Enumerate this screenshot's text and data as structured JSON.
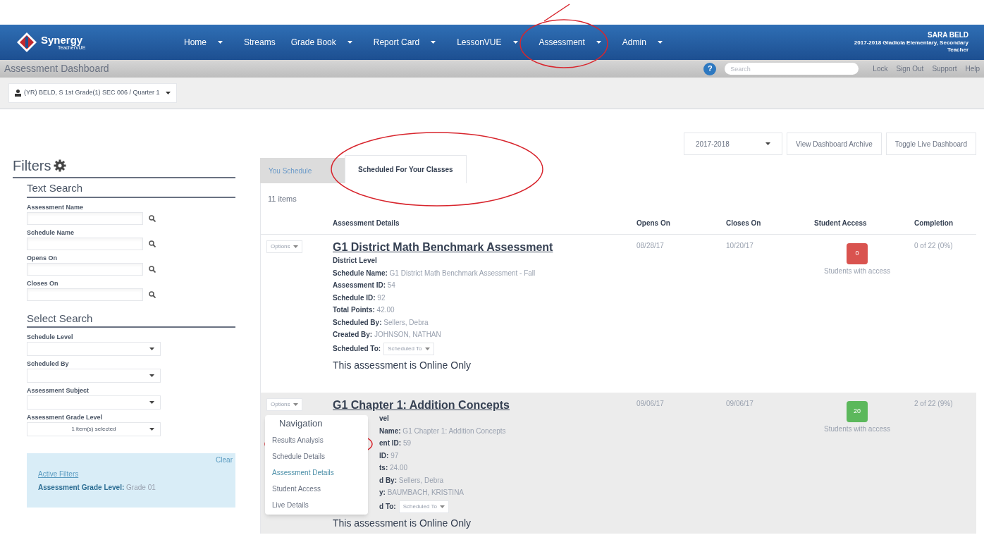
{
  "top_nav": {
    "logo_text": "Synergy",
    "logo_sub": "TeacherVUE",
    "items": [
      {
        "label": "Home",
        "dropdown": true
      },
      {
        "label": "Streams",
        "dropdown": false
      },
      {
        "label": "Grade Book",
        "dropdown": true
      },
      {
        "label": "Report Card",
        "dropdown": true
      },
      {
        "label": "LessonVUE",
        "dropdown": true
      },
      {
        "label": "Assessment",
        "dropdown": true
      },
      {
        "label": "Admin",
        "dropdown": true
      }
    ],
    "user": {
      "name": "SARA BELD",
      "school": "2017-2018 Gladiola Elementary, Secondary",
      "role": "Teacher"
    }
  },
  "sub_bar": {
    "title": "Assessment Dashboard",
    "help_icon": "?",
    "search": {
      "placeholder": "Search"
    },
    "links": [
      "Lock",
      "Sign Out",
      "Support",
      "Help"
    ]
  },
  "section_selector": "(YR) BELD, S 1st Grade(1) SEC 006 / Quarter 1",
  "filters": {
    "title": "Filters",
    "text_search": {
      "title": "Text Search",
      "fields": [
        {
          "label": "Assessment Name"
        },
        {
          "label": "Schedule Name"
        },
        {
          "label": "Opens On"
        },
        {
          "label": "Closes On"
        }
      ]
    },
    "select_search": {
      "title": "Select Search",
      "fields": [
        {
          "label": "Schedule Level"
        },
        {
          "label": "Scheduled By"
        },
        {
          "label": "Assessment Subject"
        },
        {
          "label": "Assessment Grade Level",
          "value": "1 item(s) selected"
        }
      ]
    },
    "active_filters": {
      "clear": "Clear",
      "title": "Active Filters",
      "items": [
        {
          "label": "Assessment Grade Level:",
          "value": "Grade 01"
        }
      ]
    }
  },
  "toolbar": {
    "year": "2017-2018",
    "buttons": [
      "View Dashboard Archive",
      "Toggle Live Dashboard"
    ]
  },
  "tabs": [
    {
      "label": "You Schedule",
      "selected": false
    },
    {
      "label": "Scheduled For Your Classes",
      "selected": true
    }
  ],
  "item_count": "11 items",
  "table": {
    "columns": [
      "Assessment Details",
      "Opens On",
      "Closes On",
      "Student Access",
      "Completion"
    ],
    "rows": [
      {
        "options": "Options",
        "title": "G1 District Math Benchmark Assessment",
        "level": "District Level",
        "details": [
          {
            "label": "Schedule Name:",
            "value": "G1 District Math Benchmark Assessment - Fall"
          },
          {
            "label": "Assessment ID:",
            "value": "54"
          },
          {
            "label": "Schedule ID:",
            "value": "92"
          },
          {
            "label": "Total Points:",
            "value": "42.00"
          },
          {
            "label": "Scheduled By:",
            "value": "Sellers, Debra"
          },
          {
            "label": "Created By:",
            "value": "JOHNSON, NATHAN"
          }
        ],
        "scheduled_to": {
          "label": "Scheduled To:",
          "button": "Scheduled To"
        },
        "note": "This assessment is Online Only",
        "opens": "08/28/17",
        "closes": "10/20/17",
        "access_count": "0",
        "color": "#d9534f",
        "access_label": "Students with access",
        "completion": "0 of 22 (0%)",
        "highlighted": false,
        "menu_open": false
      },
      {
        "options": "Options",
        "title": "G1 Chapter 1: Addition Concepts",
        "level": "vel",
        "details": [
          {
            "label": "Name:",
            "value": "G1 Chapter 1: Addition Concepts"
          },
          {
            "label": "ent ID:",
            "value": "59"
          },
          {
            "label": "ID:",
            "value": "97"
          },
          {
            "label": "ts:",
            "value": "24.00"
          },
          {
            "label": "d By:",
            "value": "Sellers, Debra"
          },
          {
            "label": "y:",
            "value": "BAUMBACH, KRISTINA"
          }
        ],
        "scheduled_to": {
          "label": "d To:",
          "button": "Scheduled To"
        },
        "note": "This assessment is Online Only",
        "opens": "09/06/17",
        "closes": "09/06/17",
        "access_count": "20",
        "color": "#5cb85c",
        "access_label": "Students with access",
        "completion": "2 of 22 (9%)",
        "highlighted": true,
        "menu_open": true
      }
    ]
  },
  "options_menu": {
    "header": "Navigation",
    "items": [
      {
        "label": "Results Analysis",
        "selected": false
      },
      {
        "label": "Schedule Details",
        "selected": false
      },
      {
        "label": "Assessment Details",
        "selected": true
      },
      {
        "label": "Student Access",
        "selected": false
      },
      {
        "label": "Live Details",
        "selected": false
      }
    ]
  }
}
